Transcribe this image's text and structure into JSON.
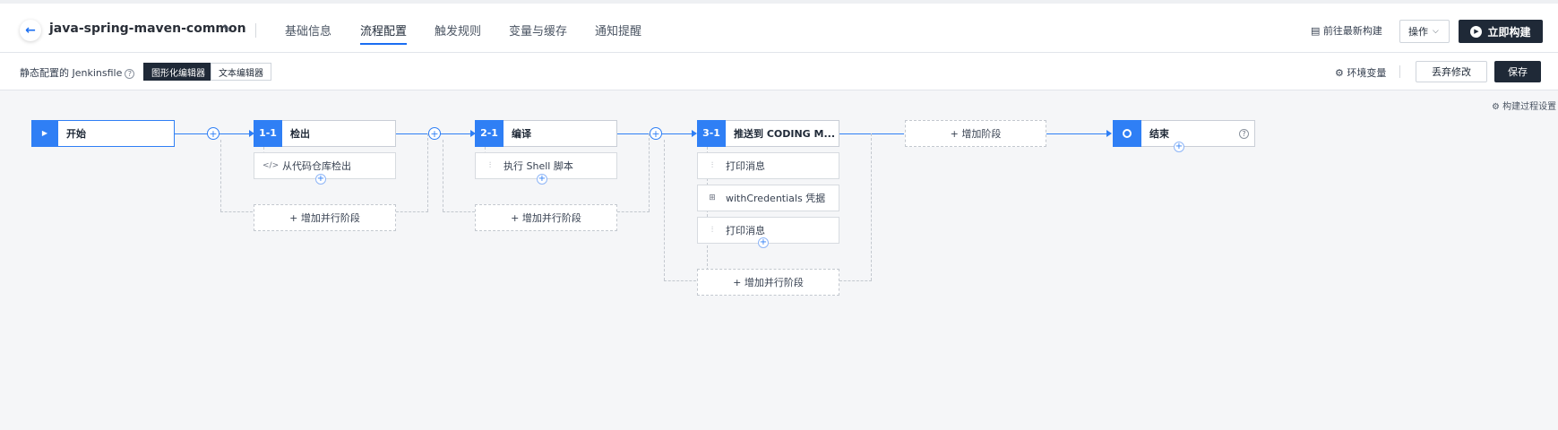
{
  "header": {
    "project_title": "java-spring-maven-common",
    "tabs": [
      {
        "label": "基础信息"
      },
      {
        "label": "流程配置"
      },
      {
        "label": "触发规则"
      },
      {
        "label": "变量与缓存"
      },
      {
        "label": "通知提醒"
      }
    ],
    "active_tab": "流程配置",
    "latest_build_label": "前往最新构建",
    "operation_label": "操作",
    "build_now_label": "立即构建"
  },
  "toolbar": {
    "static_config_label": "静态配置的 Jenkinsfile",
    "graphic_editor_label": "图形化编辑器",
    "text_editor_label": "文本编辑器",
    "env_vars_label": "环境变量",
    "discard_label": "丢弃修改",
    "save_label": "保存"
  },
  "pipeline": {
    "build_settings_label": "构建过程设置",
    "start": {
      "label": "开始"
    },
    "stages": [
      {
        "index": "1-1",
        "name": "检出",
        "steps": [
          {
            "icon": "code-icon",
            "label": "从代码仓库检出"
          }
        ]
      },
      {
        "index": "2-1",
        "name": "编译",
        "steps": [
          {
            "icon": "sliders-icon",
            "label": "执行 Shell 脚本"
          }
        ]
      },
      {
        "index": "3-1",
        "name": "推送到 CODING M...",
        "steps": [
          {
            "icon": "sliders-icon",
            "label": "打印消息"
          },
          {
            "icon": "grid-icon",
            "label": "withCredentials 凭据"
          },
          {
            "icon": "sliders-icon",
            "label": "打印消息"
          }
        ]
      }
    ],
    "add_parallel_label": "+ 增加并行阶段",
    "add_stage_label": "+ 增加阶段",
    "end": {
      "label": "结束"
    }
  },
  "colors": {
    "accent": "#2f7ff5",
    "dark": "#1f2937"
  }
}
